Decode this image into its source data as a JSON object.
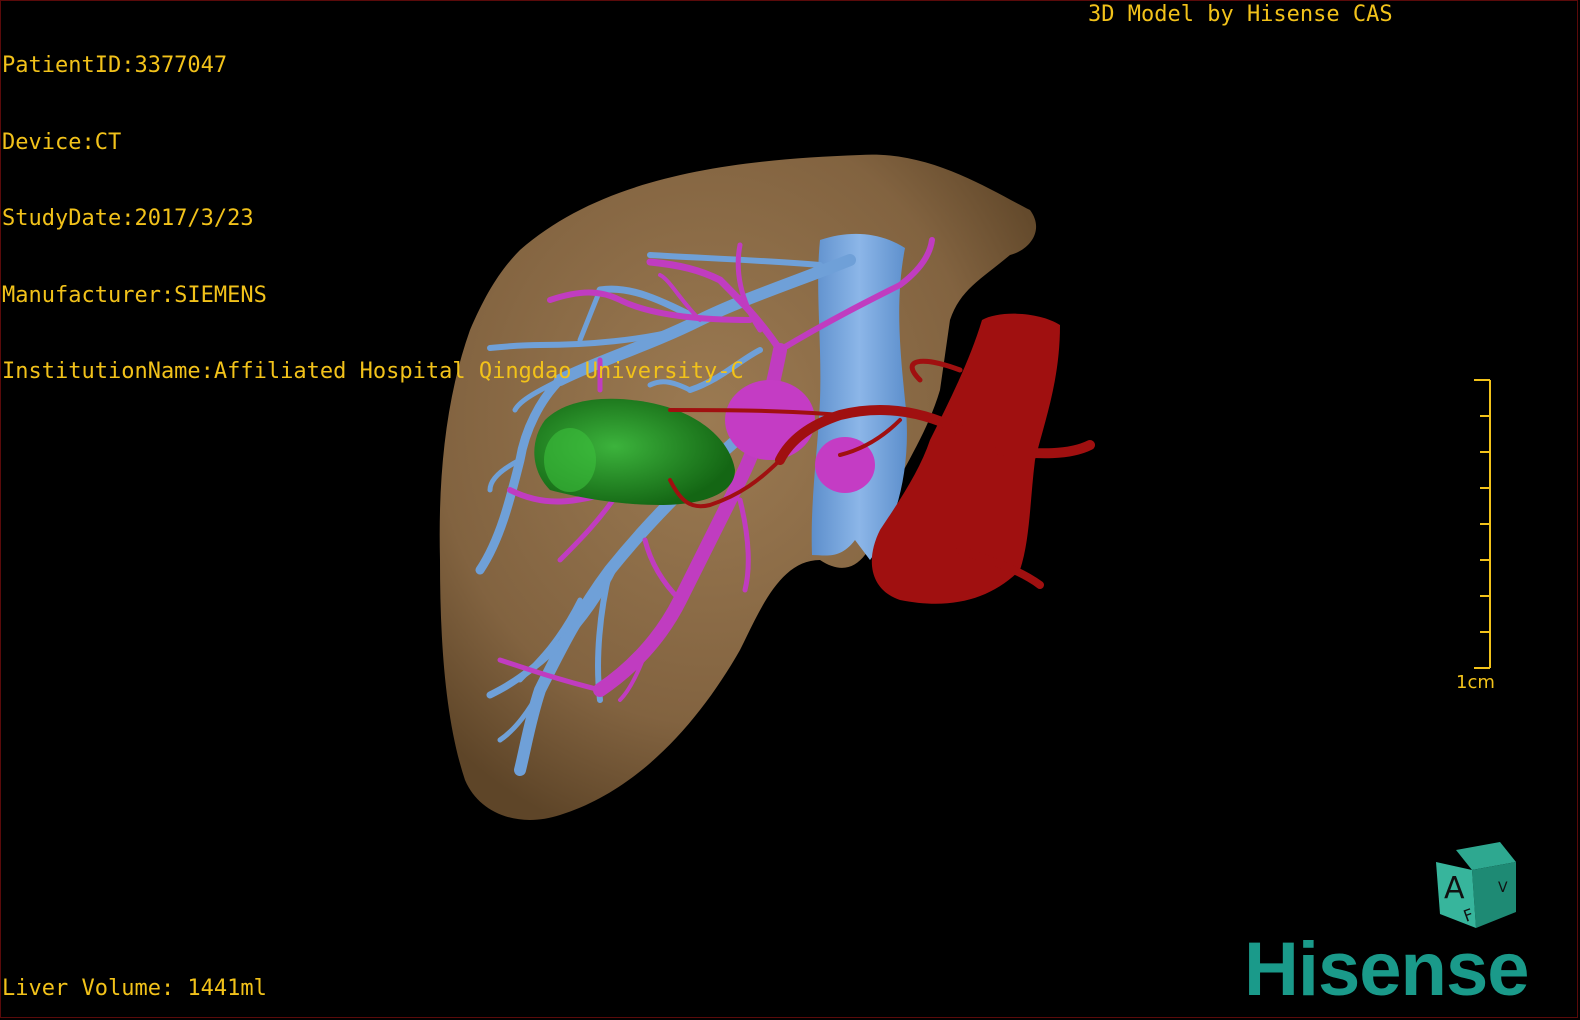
{
  "header": {
    "info_lines": [
      "PatientID:3377047",
      "Device:CT",
      "StudyDate:2017/3/23",
      "Manufacturer:SIEMENS",
      "InstitutionName:Affiliated Hospital Qingdao University-C"
    ],
    "model_credit": "3D Model by Hisense CAS"
  },
  "footer": {
    "liver_volume": "Liver Volume: 1441ml"
  },
  "scale_bar": {
    "label": "1cm",
    "ticks": 9
  },
  "orientation_cube": {
    "front_face": "A",
    "top_face": "F",
    "side_face": "V"
  },
  "brand": {
    "logo_text": "Hisense"
  },
  "colors": {
    "overlay_text": "#f2c21a",
    "liver": "#8a6a45",
    "portal_vein": "#6fa0d8",
    "hepatic_vein": "#c03cc0",
    "artery": "#a01010",
    "tumor": "#1e8a1e",
    "logo": "#1a9a8a"
  }
}
